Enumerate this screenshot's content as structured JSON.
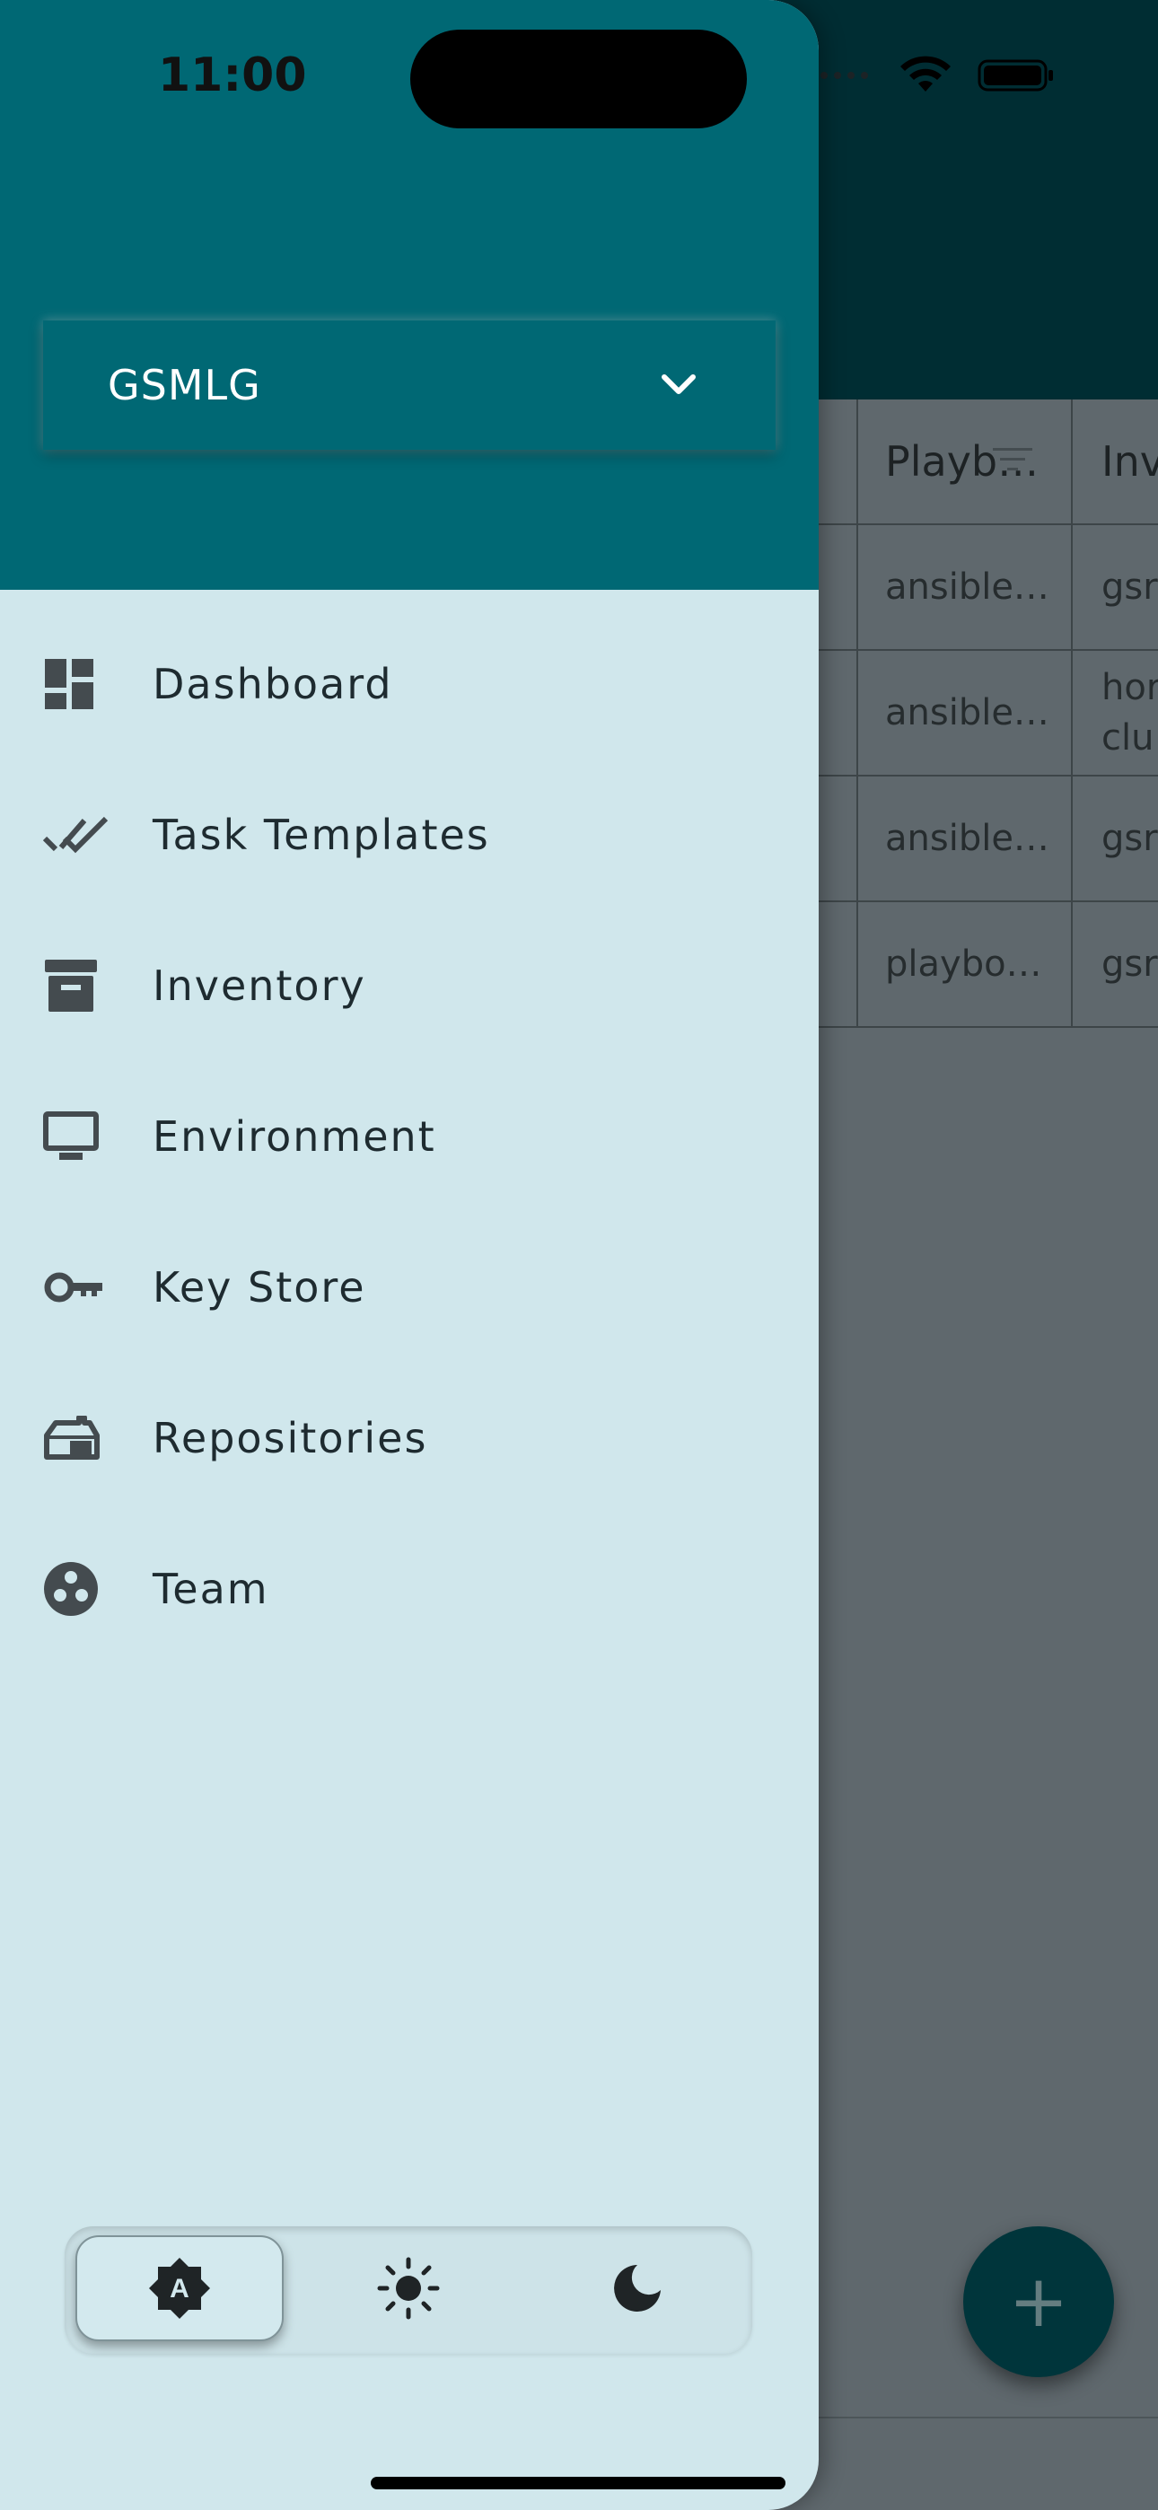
{
  "status_bar": {
    "time": "11:00"
  },
  "background_table": {
    "headers": [
      "Playb…",
      "Inv"
    ],
    "rows": [
      {
        "playbook": "ansible…",
        "inventory": [
          "gsr"
        ]
      },
      {
        "playbook": "ansible…",
        "inventory": [
          "hor",
          "clu"
        ]
      },
      {
        "playbook": "ansible…",
        "inventory": [
          "gsr"
        ]
      },
      {
        "playbook": "playbo…",
        "inventory": [
          "gsr"
        ]
      }
    ]
  },
  "fab": {
    "label": "+"
  },
  "drawer": {
    "project_selector": {
      "value": "GSMLG"
    },
    "nav_items": [
      {
        "label": "Dashboard",
        "icon": "dashboard-icon"
      },
      {
        "label": "Task Templates",
        "icon": "done-all-icon"
      },
      {
        "label": "Inventory",
        "icon": "archive-icon"
      },
      {
        "label": "Environment",
        "icon": "monitor-icon"
      },
      {
        "label": "Key Store",
        "icon": "key-icon"
      },
      {
        "label": "Repositories",
        "icon": "repository-icon"
      },
      {
        "label": "Team",
        "icon": "team-icon"
      }
    ],
    "theme_switch": {
      "options": [
        "auto-brightness-icon",
        "light-mode-icon",
        "dark-mode-icon"
      ],
      "selected": "auto",
      "auto_glyph": "A"
    }
  },
  "colors": {
    "primary": "#006874",
    "drawer_bg": "#d0e7ec",
    "scrim": "#5f686d"
  }
}
